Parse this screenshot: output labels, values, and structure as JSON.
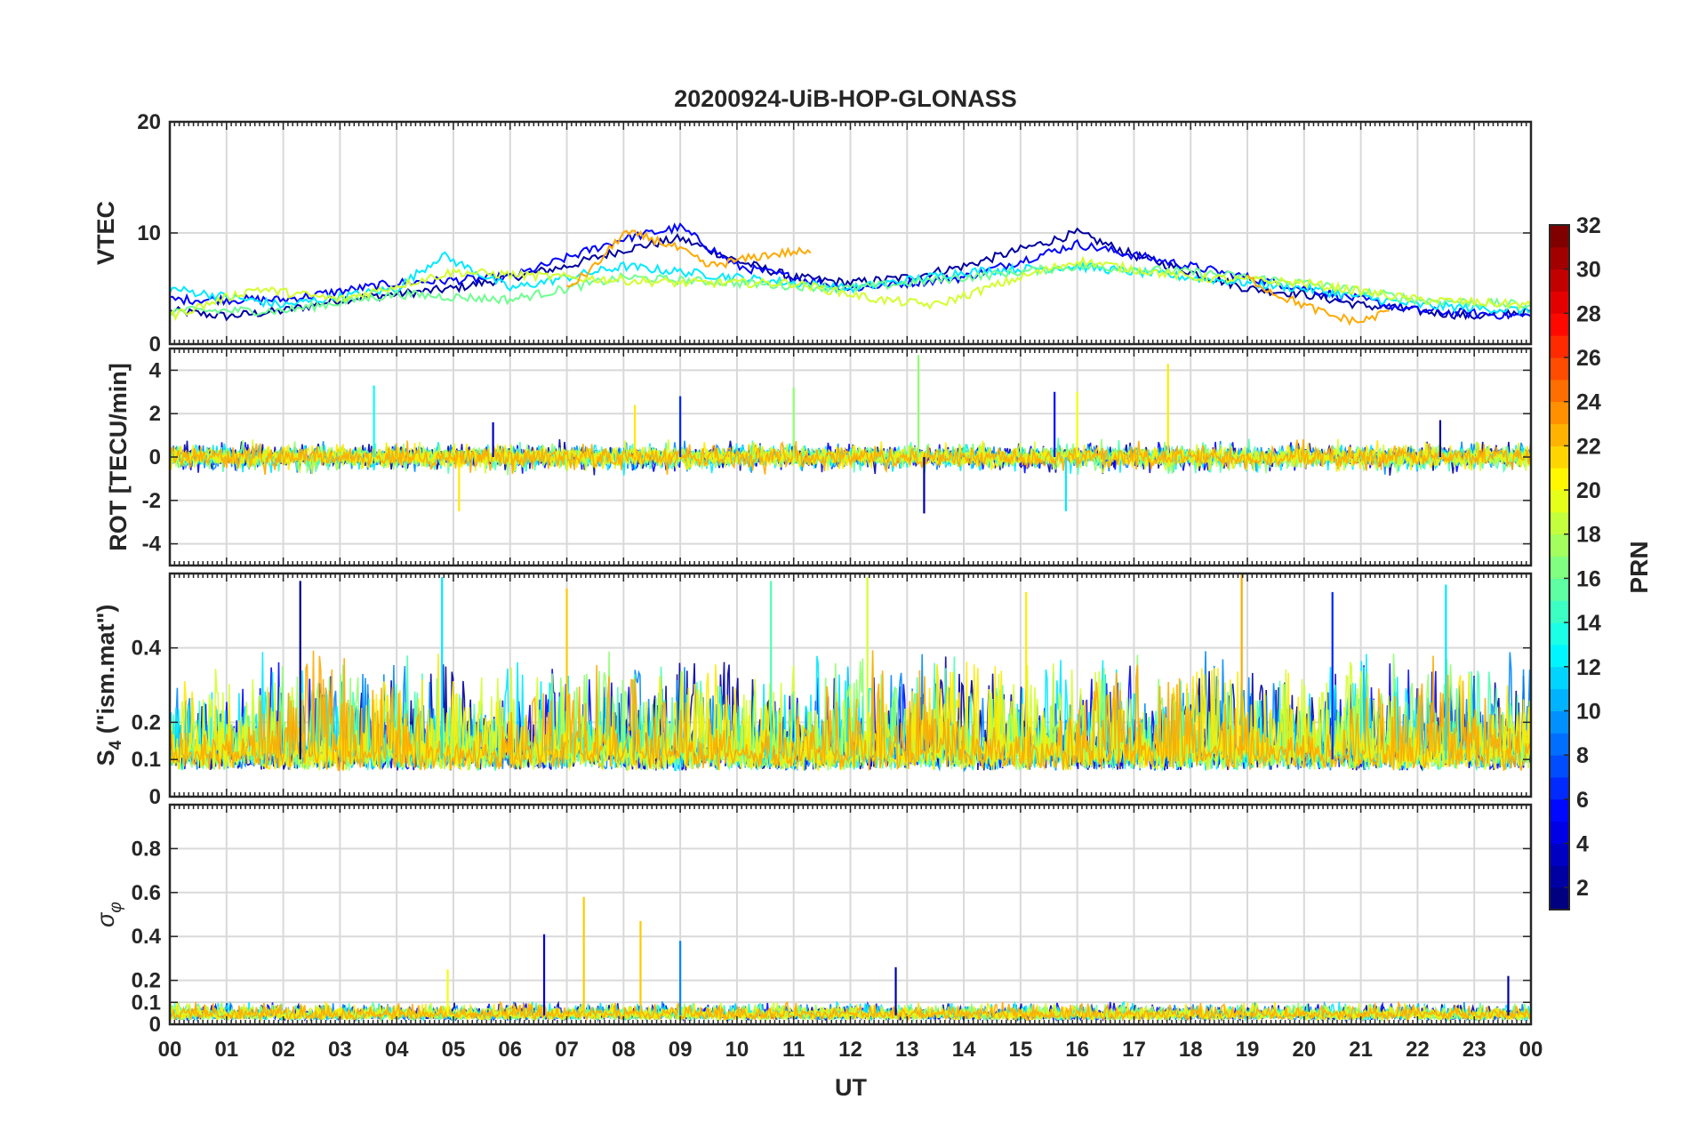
{
  "chart_data": {
    "type": "line",
    "title": "20200924-UiB-HOP-GLONASS",
    "xlabel": "UT",
    "x_ticks": [
      "00",
      "01",
      "02",
      "03",
      "04",
      "05",
      "06",
      "07",
      "08",
      "09",
      "10",
      "11",
      "12",
      "13",
      "14",
      "15",
      "16",
      "17",
      "18",
      "19",
      "20",
      "21",
      "22",
      "23",
      "00"
    ],
    "xlim_hours": [
      0,
      24
    ],
    "grid": true,
    "colormap": "jet",
    "colorbar": {
      "label": "PRN",
      "ticks": [
        "2",
        "4",
        "6",
        "8",
        "10",
        "12",
        "14",
        "16",
        "18",
        "20",
        "22",
        "24",
        "26",
        "28",
        "30",
        "32"
      ],
      "range": [
        1,
        32
      ]
    },
    "panels": [
      {
        "name": "vtec",
        "ylabel": "VTEC",
        "ylim": [
          0,
          20
        ],
        "yticks": [
          "0",
          "10",
          "20"
        ],
        "series": [
          {
            "prn": 2,
            "hours": [
              0,
              1,
              2,
              3,
              4,
              5,
              6,
              7,
              8,
              9,
              10,
              11,
              12,
              13,
              14,
              15,
              16,
              17,
              18,
              19,
              20,
              21,
              22,
              23,
              24
            ],
            "values": [
              3,
              2.5,
              3,
              4,
              4.5,
              5,
              6,
              7,
              8.5,
              9.5,
              7.5,
              6,
              5.5,
              6,
              7,
              8.5,
              10,
              8,
              6.5,
              5,
              4.5,
              3.5,
              3,
              2.5,
              3
            ]
          },
          {
            "prn": 5,
            "hours": [
              0,
              2,
              4,
              6,
              8,
              9,
              10,
              12,
              14,
              16,
              18,
              20,
              22,
              24
            ],
            "values": [
              4,
              4,
              5.5,
              6,
              9.5,
              10.5,
              7,
              5,
              6,
              9,
              7,
              5,
              3,
              2.5
            ]
          },
          {
            "prn": 12,
            "hours": [
              0,
              2,
              4,
              4.8,
              6,
              8,
              10,
              12,
              14,
              16,
              18,
              20,
              22,
              24
            ],
            "values": [
              5,
              3.5,
              5,
              8,
              5,
              7,
              6,
              5,
              6.5,
              7,
              6,
              5,
              3.5,
              3
            ]
          },
          {
            "prn": 16,
            "hours": [
              0,
              2,
              4,
              6,
              8,
              10,
              12,
              14,
              16,
              18,
              20,
              22,
              24
            ],
            "values": [
              3,
              3,
              4.5,
              4,
              6,
              5.5,
              5,
              6,
              7,
              6.5,
              5.5,
              4,
              3.5
            ]
          },
          {
            "prn": 19,
            "hours": [
              0,
              1.5,
              3,
              5,
              7,
              9,
              11,
              12.5,
              13.5,
              15,
              16,
              18,
              20,
              22,
              24
            ],
            "values": [
              2.5,
              5,
              4,
              6.5,
              6,
              5.5,
              5.5,
              4,
              3.5,
              6,
              7.5,
              6,
              5.5,
              4,
              3.5
            ]
          },
          {
            "prn": 23,
            "hours": [
              7,
              7.5,
              8,
              8.5,
              9,
              9.5,
              10,
              10.5,
              11,
              11.3
            ],
            "values": [
              5,
              7,
              10,
              9.5,
              8.5,
              7,
              7.5,
              8,
              8.3,
              8.2
            ]
          },
          {
            "prn": 23,
            "hours": [
              19,
              19.5,
              20,
              20.5,
              21,
              21.5
            ],
            "values": [
              6,
              4.5,
              3.5,
              2.5,
              2,
              3
            ]
          }
        ]
      },
      {
        "name": "rot",
        "ylabel": "ROT [TECU/min]",
        "ylim": [
          -5,
          5
        ],
        "yticks": [
          "-4",
          "-2",
          "0",
          "2",
          "4"
        ],
        "spikes": [
          {
            "prn": 13,
            "hour": 3.6,
            "value": 3.3
          },
          {
            "prn": 21,
            "hour": 5.1,
            "value": -2.5
          },
          {
            "prn": 3,
            "hour": 5.7,
            "value": 1.6
          },
          {
            "prn": 21,
            "hour": 8.2,
            "value": 2.4
          },
          {
            "prn": 6,
            "hour": 9.0,
            "value": 2.8
          },
          {
            "prn": 17,
            "hour": 11.0,
            "value": 3.2
          },
          {
            "prn": 17,
            "hour": 13.2,
            "value": 4.7
          },
          {
            "prn": 2,
            "hour": 13.3,
            "value": -2.6
          },
          {
            "prn": 5,
            "hour": 15.6,
            "value": 3.0
          },
          {
            "prn": 20,
            "hour": 16.0,
            "value": 3.0
          },
          {
            "prn": 12,
            "hour": 15.8,
            "value": -2.5
          },
          {
            "prn": 21,
            "hour": 17.6,
            "value": 4.3
          },
          {
            "prn": 2,
            "hour": 22.4,
            "value": 1.7
          }
        ]
      },
      {
        "name": "s4",
        "ylabel": "S4 (\"ism.mat\")",
        "ylabel_main": "S",
        "ylabel_sub": "4",
        "ylabel_rest": " (\"ism.mat\")",
        "ylim": [
          0,
          0.6
        ],
        "yticks": [
          "0",
          "0.1",
          "0.2",
          "0.4"
        ],
        "spikes": [
          {
            "prn": 1,
            "hour": 2.3,
            "value": 0.58
          },
          {
            "prn": 12,
            "hour": 4.8,
            "value": 0.59
          },
          {
            "prn": 22,
            "hour": 7.0,
            "value": 0.56
          },
          {
            "prn": 15,
            "hour": 10.6,
            "value": 0.58
          },
          {
            "prn": 19,
            "hour": 12.3,
            "value": 0.59
          },
          {
            "prn": 21,
            "hour": 15.1,
            "value": 0.55
          },
          {
            "prn": 23,
            "hour": 18.9,
            "value": 0.6
          },
          {
            "prn": 6,
            "hour": 20.5,
            "value": 0.55
          },
          {
            "prn": 12,
            "hour": 22.5,
            "value": 0.57
          }
        ]
      },
      {
        "name": "sigma_phi",
        "ylabel": "σ_φ",
        "ylabel_main": "σ",
        "ylabel_sub": "φ",
        "ylim": [
          0,
          1
        ],
        "yticks": [
          "0",
          "0.1",
          "0.2",
          "0.4",
          "0.6",
          "0.8"
        ],
        "spikes": [
          {
            "prn": 4,
            "hour": 6.6,
            "value": 0.41
          },
          {
            "prn": 22,
            "hour": 7.3,
            "value": 0.58
          },
          {
            "prn": 22,
            "hour": 8.3,
            "value": 0.47
          },
          {
            "prn": 9,
            "hour": 9.0,
            "value": 0.38
          },
          {
            "prn": 20,
            "hour": 4.9,
            "value": 0.25
          },
          {
            "prn": 2,
            "hour": 12.8,
            "value": 0.26
          },
          {
            "prn": 2,
            "hour": 23.6,
            "value": 0.22
          }
        ]
      }
    ]
  }
}
